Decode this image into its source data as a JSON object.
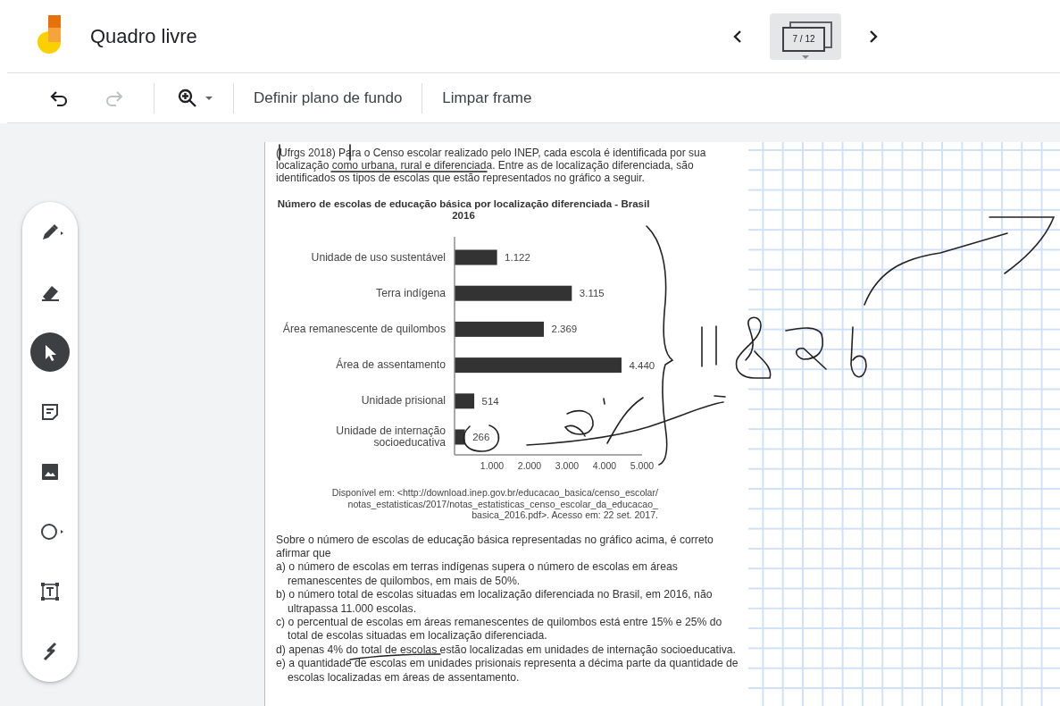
{
  "header": {
    "title": "Quadro livre",
    "frame_counter": "7 / 12"
  },
  "toolbar": {
    "buttons": [
      {
        "kind": "undo",
        "disabled": false
      },
      {
        "kind": "redo",
        "disabled": true
      },
      {
        "kind": "zoom",
        "disabled": false
      }
    ],
    "actions": [
      "Definir plano de fundo",
      "Limpar frame"
    ]
  },
  "palette": [
    {
      "kind": "pen",
      "selected": false
    },
    {
      "kind": "eraser",
      "selected": false
    },
    {
      "kind": "select",
      "selected": true
    },
    {
      "kind": "note",
      "selected": false
    },
    {
      "kind": "image",
      "selected": false
    },
    {
      "kind": "circle",
      "selected": false
    },
    {
      "kind": "textbox",
      "selected": false
    },
    {
      "kind": "laser",
      "selected": false
    }
  ],
  "document": {
    "intro": "(Ufrgs 2018) Para o Censo escolar realizado pelo INEP, cada escola é identificada por sua localização como urbana, rural e diferenciada. Entre as de localização diferenciada, são identificados os tipos de escolas que estão representados no gráfico a seguir.",
    "chart_data": {
      "type": "bar",
      "orientation": "horizontal",
      "title": "Número de escolas de educação básica por localização diferenciada - Brasil 2016",
      "categories": [
        "Unidade de uso sustentável",
        "Terra indígena",
        "Área remanescente de quilombos",
        "Área de assentamento",
        "Unidade prisional",
        "Unidade de internação socioeducativa"
      ],
      "series": [
        {
          "color": "#333333",
          "values": [
            1122,
            3115,
            2369,
            4440,
            514,
            266
          ]
        }
      ],
      "value_labels": [
        "1.122",
        "3.115",
        "2.369",
        "4.440",
        "514",
        "266"
      ],
      "xlim": [
        0,
        5000
      ],
      "xticks": [
        {
          "value": 1000,
          "label": "1.000"
        },
        {
          "value": 2000,
          "label": "2.000"
        },
        {
          "value": 3000,
          "label": "3.000"
        },
        {
          "value": 4000,
          "label": "4.000"
        },
        {
          "value": 5000,
          "label": "5.000"
        }
      ]
    },
    "source": [
      "Disponível em: <http://download.inep.gov.br/educacao_basica/censo_escolar/",
      "notas_estatisticas/2017/notas_estatisticas_censo_escolar_da_educacao_",
      "basica_2016.pdf>. Acesso em: 22 set. 2017."
    ],
    "question": "Sobre o número de escolas de educação básica representadas no gráfico acima, é correto afirmar que",
    "options": [
      "a) o número de escolas em terras indígenas supera o número de escolas em áreas remanescentes de quilombos, em mais de 50%.",
      "b) o número total de escolas situadas em localização diferenciada no Brasil, em 2016, não ultrapassa 11.000 escolas.",
      "c) o percentual de escolas em áreas remanescentes de quilombos está entre 15% e 25% do total de escolas situadas em localização diferenciada.",
      "d) apenas 4% do total de escolas estão localizadas em unidades de internação socioeducativa.",
      "e) a quantidade de escolas em unidades prisionais representa a décima parte da quantidade de escolas localizadas em áreas de assentamento."
    ]
  }
}
